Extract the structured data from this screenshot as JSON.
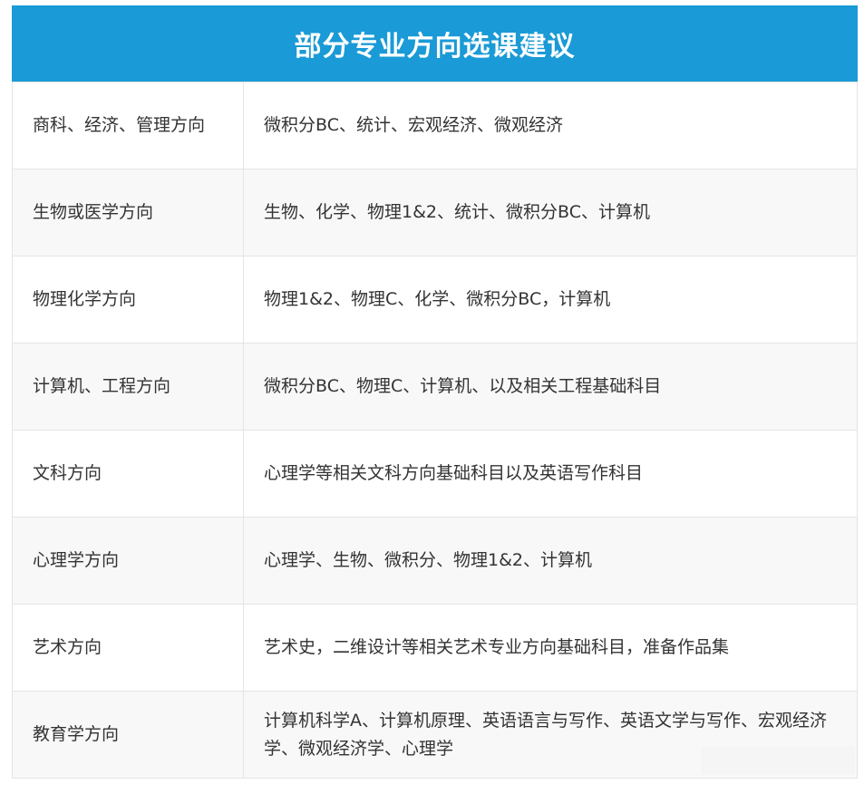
{
  "title": "部分专业方向选课建议",
  "rows": [
    {
      "major": "商科、经济、管理方向",
      "courses": "微积分BC、统计、宏观经济、微观经济"
    },
    {
      "major": "生物或医学方向",
      "courses": "生物、化学、物理1&2、统计、微积分BC、计算机"
    },
    {
      "major": "物理化学方向",
      "courses": "物理1&2、物理C、化学、微积分BC，计算机"
    },
    {
      "major": "计算机、工程方向",
      "courses": "微积分BC、物理C、计算机、以及相关工程基础科目"
    },
    {
      "major": "文科方向",
      "courses": "心理学等相关文科方向基础科目以及英语写作科目"
    },
    {
      "major": "心理学方向",
      "courses": "心理学、生物、微积分、物理1&2、计算机"
    },
    {
      "major": "艺术方向",
      "courses": "艺术史，二维设计等相关艺术专业方向基础科目，准备作品集"
    },
    {
      "major": "教育学方向",
      "courses": "计算机科学A、计算机原理、英语语言与写作、英语文学与写作、宏观经济学、微观经济学、心理学"
    }
  ]
}
